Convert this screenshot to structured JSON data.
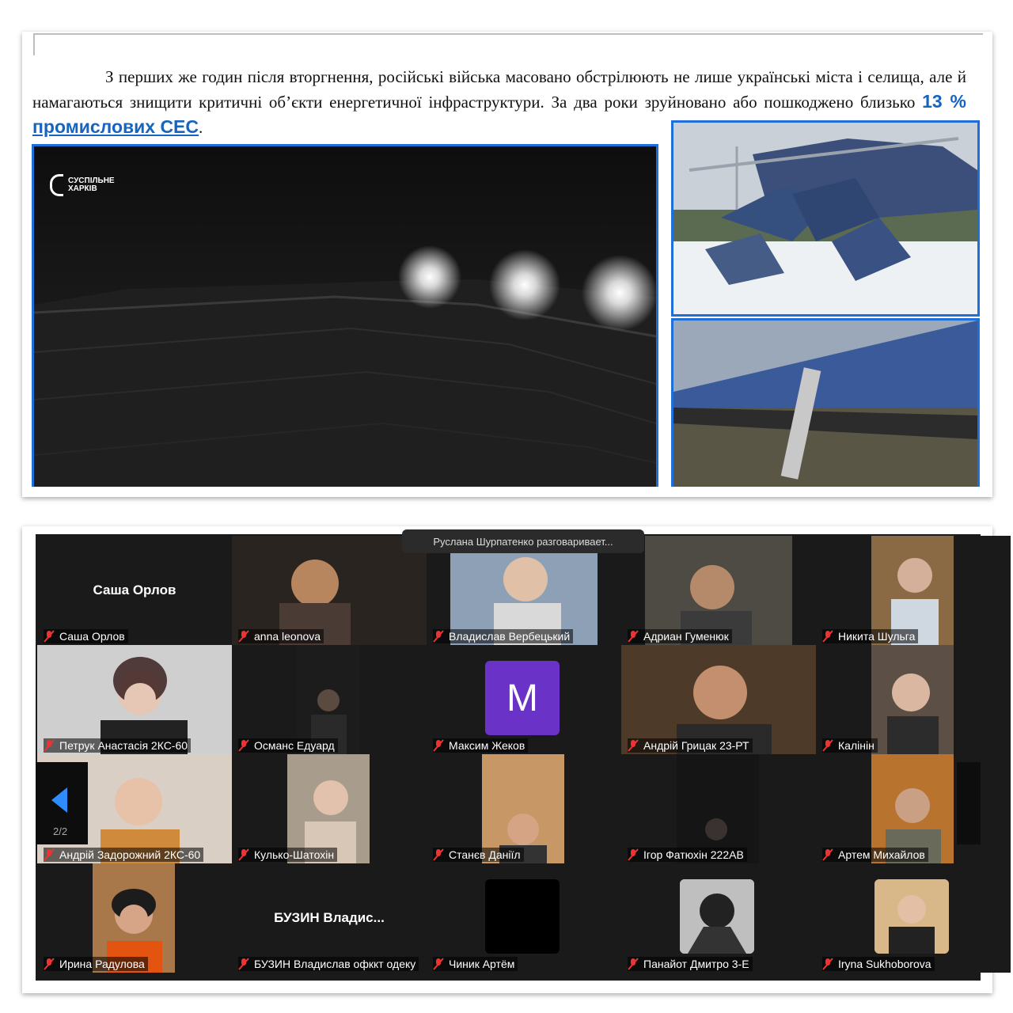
{
  "document": {
    "paragraph_lines": [
      "З перших же годин після вторгнення, російські війська масовано обстрілюють не лише українські",
      "міста і селища, але й намагаються знищити критичні об’єкти енергетичної інфраструктури. За два роки",
      "зруйновано або пошкоджено близько"
    ],
    "highlight_pre": "13 %",
    "highlight_link": "промислових СЕС",
    "highlight_end": ".",
    "video_logo_line1": "СУСПІЛЬНЕ",
    "video_logo_line2": "ХАРКІВ",
    "accent_color": "#1e6fd8"
  },
  "meeting": {
    "notification": "Руслана Шурпатенко разговаривает...",
    "page_indicator": "2/2",
    "avatar_letter": "M",
    "avatar_color": "#6b32c8",
    "participants": [
      {
        "name": "Саша Орлов",
        "display": "Саша Орлов"
      },
      {
        "name": "anna leonova"
      },
      {
        "name": "Владислав Вербецький"
      },
      {
        "name": "Адриан Гуменюк"
      },
      {
        "name": "Никита Шульга"
      },
      {
        "name": "Петрук Анастасія 2КС-60"
      },
      {
        "name": "Османс Едуард"
      },
      {
        "name": "Максим Жеков"
      },
      {
        "name": "Андрій Грицак 23-РТ"
      },
      {
        "name": "Калінін"
      },
      {
        "name": "Андрій Задорожний 2КС-60"
      },
      {
        "name": "Кулько-Шатохін"
      },
      {
        "name": "Станєв Даніїл"
      },
      {
        "name": "Ігор Фатюхін 222АВ"
      },
      {
        "name": "Артем Михайлов"
      },
      {
        "name": "Ирина Радулова"
      },
      {
        "name": "БУЗИН Владислав офккт одеку",
        "display": "БУЗИН  Владис..."
      },
      {
        "name": "Чиник Артём"
      },
      {
        "name": "Панайот Дмитро 3-Е"
      },
      {
        "name": "Iryna Sukhoborova"
      }
    ]
  }
}
